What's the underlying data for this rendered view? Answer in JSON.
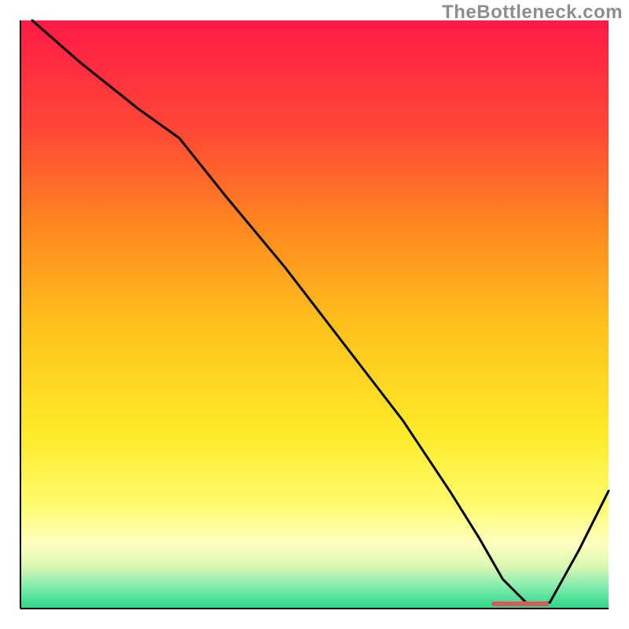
{
  "watermark": "TheBottleneck.com",
  "chart_data": {
    "type": "line",
    "title": "",
    "xlabel": "",
    "ylabel": "",
    "xlim": [
      0,
      100
    ],
    "ylim": [
      0,
      100
    ],
    "grid": false,
    "legend": false,
    "background_gradient_stops": [
      {
        "offset": 0.0,
        "color": "#ff1a47"
      },
      {
        "offset": 0.18,
        "color": "#ff4636"
      },
      {
        "offset": 0.36,
        "color": "#ff8b1e"
      },
      {
        "offset": 0.52,
        "color": "#ffc21d"
      },
      {
        "offset": 0.7,
        "color": "#ffea28"
      },
      {
        "offset": 0.82,
        "color": "#fffb6b"
      },
      {
        "offset": 0.89,
        "color": "#ffffc0"
      },
      {
        "offset": 0.93,
        "color": "#d7f7b0"
      },
      {
        "offset": 0.96,
        "color": "#8aedb0"
      },
      {
        "offset": 1.0,
        "color": "#27d888"
      }
    ],
    "series": [
      {
        "name": "curve",
        "stroke": "#000000",
        "stroke_width": 3,
        "x": [
          2,
          10,
          20,
          27,
          35,
          45,
          55,
          65,
          73,
          78,
          82,
          86,
          90,
          95,
          100
        ],
        "y": [
          100,
          93,
          85,
          80,
          70,
          58,
          45,
          32,
          20,
          12,
          5,
          1,
          1,
          10,
          20
        ]
      }
    ],
    "optimal_marker": {
      "stroke": "#d85a5a",
      "stroke_width": 6,
      "x": [
        80.5,
        89.5
      ],
      "y": [
        0.8,
        0.8
      ]
    },
    "axes": {
      "stroke": "#000000",
      "stroke_width": 2
    }
  }
}
